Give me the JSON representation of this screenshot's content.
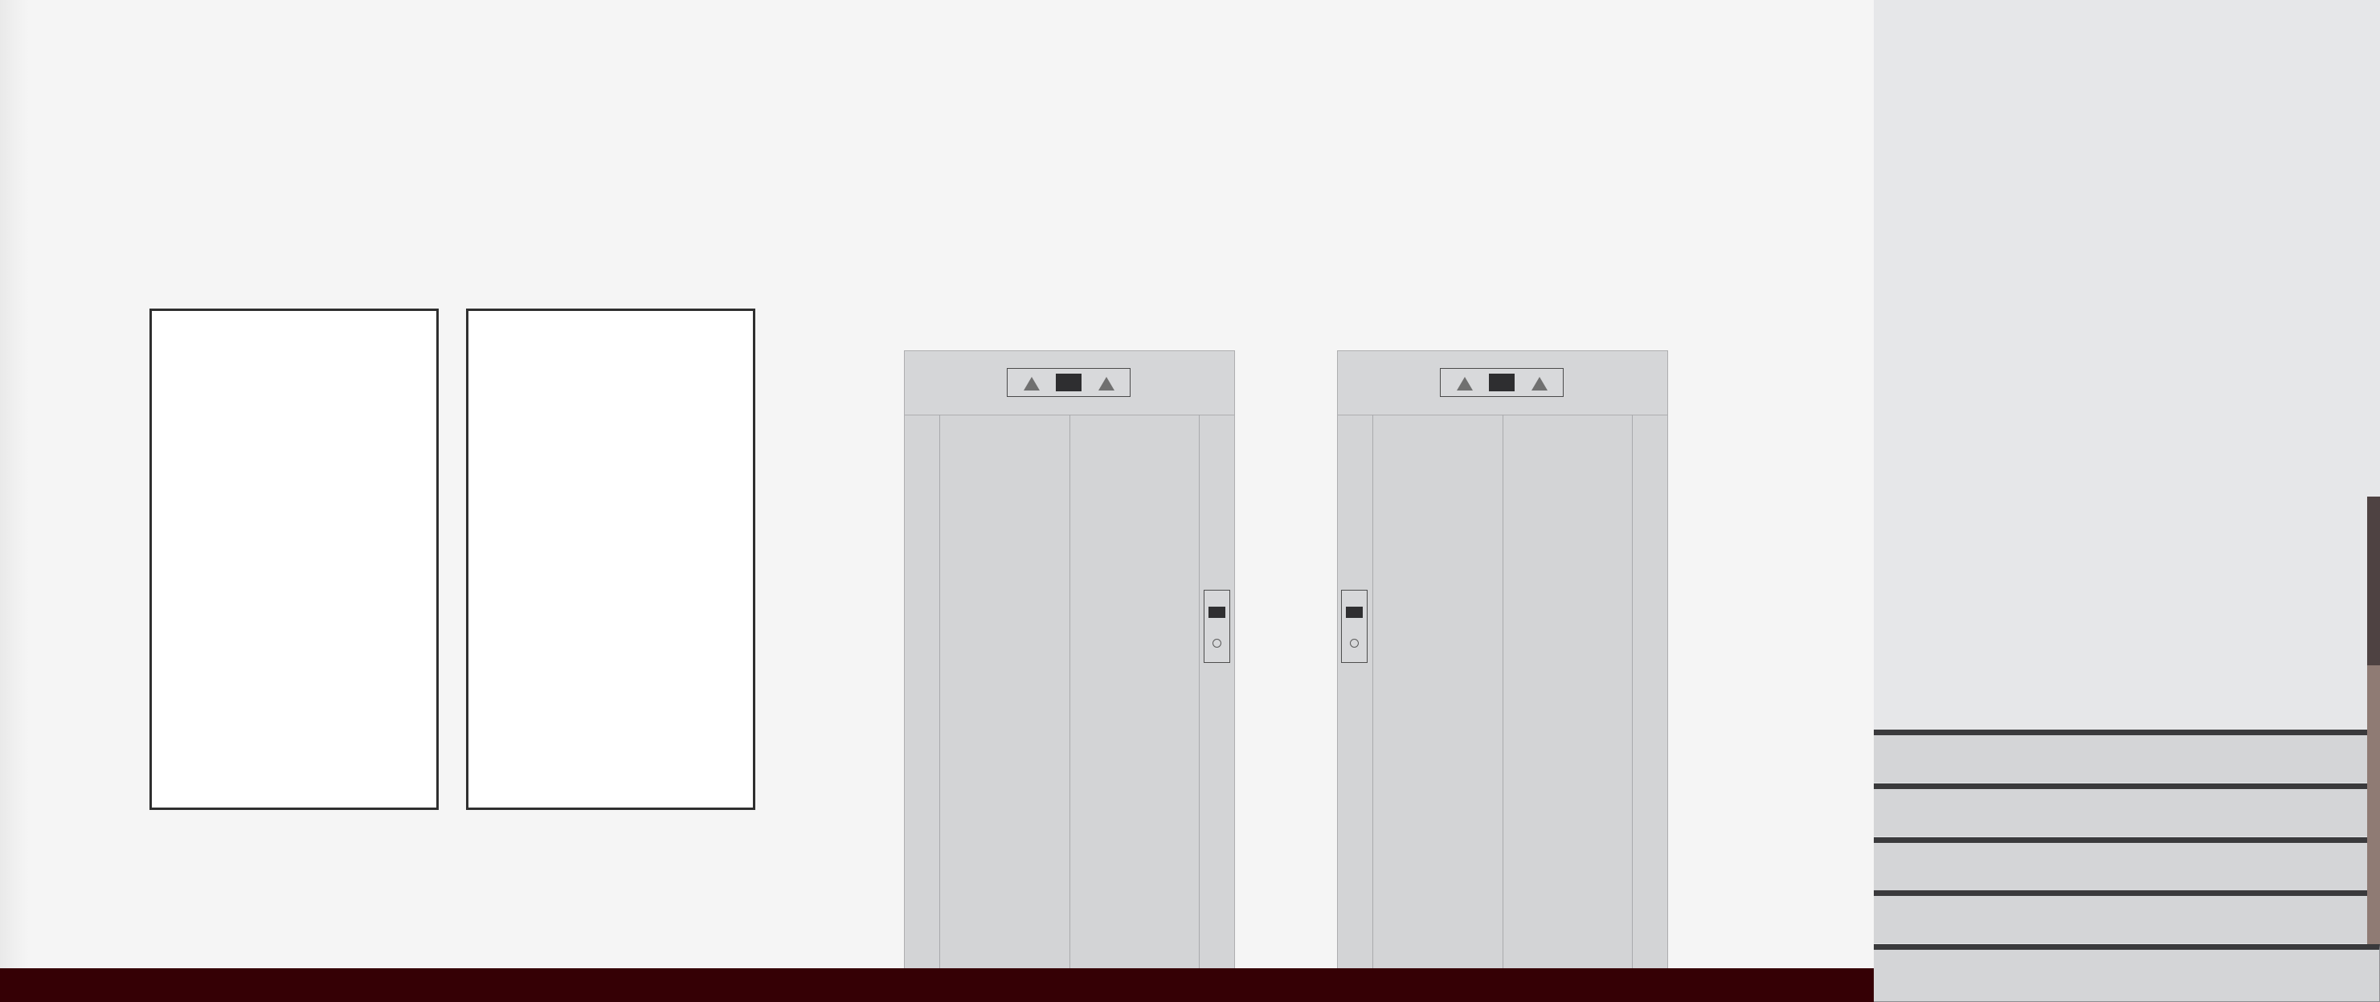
{
  "scene": {
    "wall_frames": [
      {},
      {}
    ],
    "elevators": [
      {},
      {}
    ],
    "staircase": {
      "steps": 5
    },
    "colors": {
      "wall": "#f5f5f5",
      "floor": "#350005",
      "elevator": "#d3d4d6",
      "display": "#2e2e30",
      "rail": "#8f7b74"
    }
  }
}
